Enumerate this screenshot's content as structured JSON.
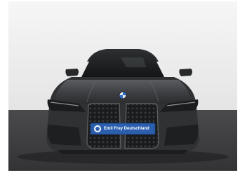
{
  "image": {
    "subject": "car-front-view",
    "colors": {
      "wall": "#ececec",
      "floor": "#3b3b3d",
      "body": "#2f3133",
      "body_highlight": "#55585b",
      "grille": "#1a1b1d",
      "plate": "#2b5fae",
      "glass": "#1f2123"
    }
  },
  "plate": {
    "dealer_name": "Emil Frey Deutschland"
  }
}
